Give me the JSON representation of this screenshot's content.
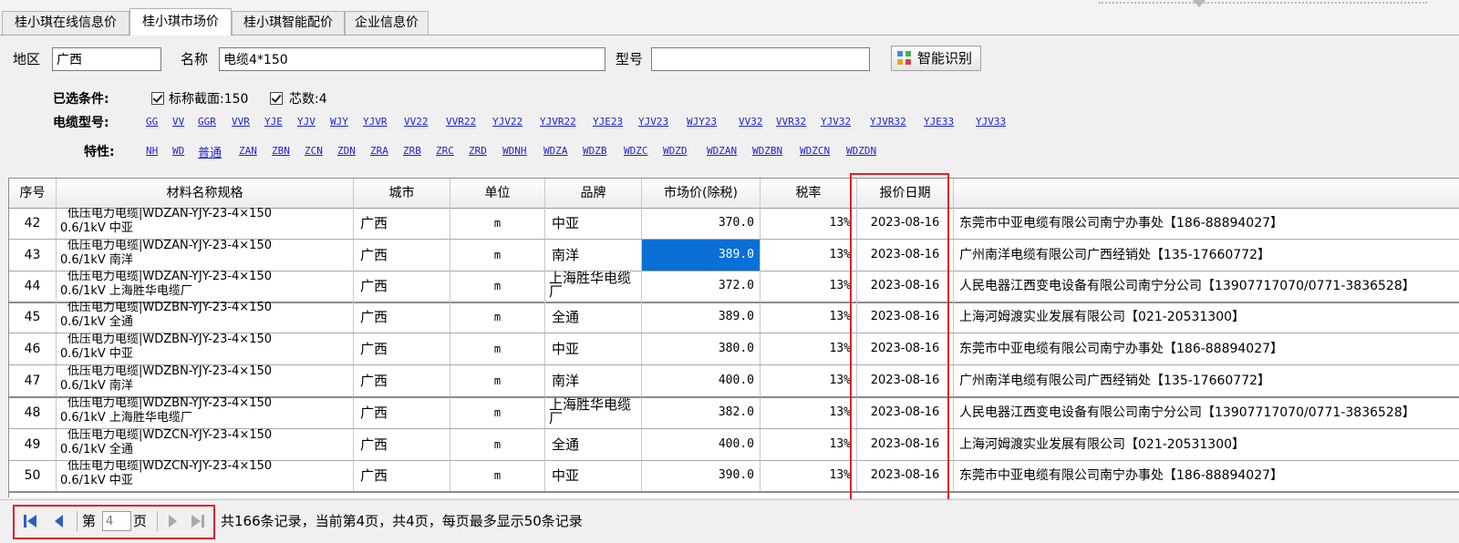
{
  "tabs": [
    {
      "label": "桂小琪在线信息价"
    },
    {
      "label": "桂小琪市场价"
    },
    {
      "label": "桂小琪智能配价"
    },
    {
      "label": "企业信息价"
    }
  ],
  "active_tab": 1,
  "filters": {
    "region_label": "地区",
    "region_value": "广西",
    "name_label": "名称",
    "name_value": "电缆4*150",
    "model_label": "型号",
    "model_value": "",
    "smart_button": "智能识别"
  },
  "conditions": {
    "selected_label": "已选条件:",
    "selected": [
      "标称截面:150",
      "芯数:4"
    ],
    "cable_model_label": "电缆型号:",
    "cable_models": [
      "GG",
      "VV",
      "GGR",
      "VVR",
      "YJE",
      "YJV",
      "WJY",
      "YJVR",
      "VV22",
      "VVR22",
      "YJV22",
      "YJVR22",
      "YJE23",
      "YJV23",
      "WJY23",
      "VV32",
      "VVR32",
      "YJV32",
      "YJVR32",
      "YJE33",
      "YJV33"
    ],
    "feature_label": "特性:",
    "features": [
      "NH",
      "WD",
      "普通",
      "ZAN",
      "ZBN",
      "ZCN",
      "ZDN",
      "ZRA",
      "ZRB",
      "ZRC",
      "ZRD",
      "WDNH",
      "WDZA",
      "WDZB",
      "WDZC",
      "WDZD",
      "WDZAN",
      "WDZBN",
      "WDZCN",
      "WDZDN"
    ]
  },
  "table": {
    "columns": [
      "序号",
      "材料名称规格",
      "城市",
      "单位",
      "品牌",
      "市场价(除税)",
      "税率",
      "报价日期"
    ],
    "rows": [
      {
        "no": "42",
        "mat1": "低压电力电缆|WDZAN-YJY-23-4×150",
        "mat2": "0.6/1kV 中亚",
        "city": "广西",
        "unit": "m",
        "brand": "中亚",
        "price": "370.0",
        "tax": "13%",
        "date": "2023-08-16",
        "supplier": "东莞市中亚电缆有限公司南宁办事处【186-88894027】"
      },
      {
        "no": "43",
        "mat1": "低压电力电缆|WDZAN-YJY-23-4×150",
        "mat2": "0.6/1kV 南洋",
        "city": "广西",
        "unit": "m",
        "brand": "南洋",
        "price": "389.0",
        "tax": "13%",
        "date": "2023-08-16",
        "supplier": "广州南洋电缆有限公司广西经销处【135-17660772】"
      },
      {
        "no": "44",
        "mat1": "低压电力电缆|WDZAN-YJY-23-4×150",
        "mat2": "0.6/1kV 上海胜华电缆厂",
        "city": "广西",
        "unit": "m",
        "brand": "上海胜华电缆厂",
        "price": "372.0",
        "tax": "13%",
        "date": "2023-08-16",
        "supplier": "人民电器江西变电设备有限公司南宁分公司【13907717070/0771-3836528】"
      },
      {
        "no": "45",
        "mat1": "低压电力电缆|WDZBN-YJY-23-4×150",
        "mat2": "0.6/1kV 全通",
        "city": "广西",
        "unit": "m",
        "brand": "全通",
        "price": "389.0",
        "tax": "13%",
        "date": "2023-08-16",
        "supplier": "上海河姆渡实业发展有限公司【021-20531300】"
      },
      {
        "no": "46",
        "mat1": "低压电力电缆|WDZBN-YJY-23-4×150",
        "mat2": "0.6/1kV 中亚",
        "city": "广西",
        "unit": "m",
        "brand": "中亚",
        "price": "380.0",
        "tax": "13%",
        "date": "2023-08-16",
        "supplier": "东莞市中亚电缆有限公司南宁办事处【186-88894027】"
      },
      {
        "no": "47",
        "mat1": "低压电力电缆|WDZBN-YJY-23-4×150",
        "mat2": "0.6/1kV 南洋",
        "city": "广西",
        "unit": "m",
        "brand": "南洋",
        "price": "400.0",
        "tax": "13%",
        "date": "2023-08-16",
        "supplier": "广州南洋电缆有限公司广西经销处【135-17660772】"
      },
      {
        "no": "48",
        "mat1": "低压电力电缆|WDZBN-YJY-23-4×150",
        "mat2": "0.6/1kV 上海胜华电缆厂",
        "city": "广西",
        "unit": "m",
        "brand": "上海胜华电缆厂",
        "price": "382.0",
        "tax": "13%",
        "date": "2023-08-16",
        "supplier": "人民电器江西变电设备有限公司南宁分公司【13907717070/0771-3836528】"
      },
      {
        "no": "49",
        "mat1": "低压电力电缆|WDZCN-YJY-23-4×150",
        "mat2": "0.6/1kV 全通",
        "city": "广西",
        "unit": "m",
        "brand": "全通",
        "price": "400.0",
        "tax": "13%",
        "date": "2023-08-16",
        "supplier": "上海河姆渡实业发展有限公司【021-20531300】"
      },
      {
        "no": "50",
        "mat1": "低压电力电缆|WDZCN-YJY-23-4×150",
        "mat2": "0.6/1kV 中亚",
        "city": "广西",
        "unit": "m",
        "brand": "中亚",
        "price": "390.0",
        "tax": "13%",
        "date": "2023-08-16",
        "supplier": "东莞市中亚电缆有限公司南宁办事处【186-88894027】"
      }
    ],
    "selected_row": 1
  },
  "pager": {
    "page_prefix": "第",
    "page_value": "4",
    "page_suffix": "页",
    "summary": "共166条记录，当前第4页，共4页，每页最多显示50条记录"
  },
  "colors": {
    "highlight_box": "#e0202a",
    "selected_cell": "#0a6fd6",
    "link": "#1f1fd6"
  }
}
